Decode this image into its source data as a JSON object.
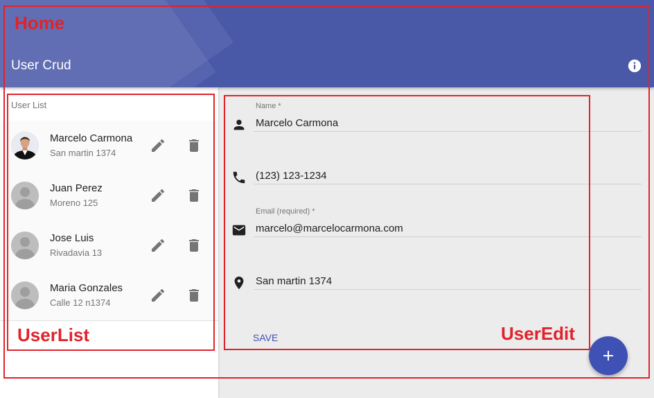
{
  "toolbar": {
    "title": "User Crud",
    "info_icon": "info-icon",
    "color": "#4a58a8"
  },
  "sidebar": {
    "subheader": "User List",
    "users": [
      {
        "name": "Marcelo Carmona",
        "address": "San martin 1374",
        "avatar": "photo"
      },
      {
        "name": "Juan Perez",
        "address": "Moreno 125",
        "avatar": "placeholder"
      },
      {
        "name": "Jose Luis",
        "address": "Rivadavia 13",
        "avatar": "placeholder"
      },
      {
        "name": "Maria Gonzales",
        "address": "Calle 12 n1374",
        "avatar": "placeholder"
      }
    ],
    "edit_icon": "pencil-icon",
    "delete_icon": "trash-icon"
  },
  "form": {
    "name": {
      "label": "Name *",
      "value": "Marcelo Carmona",
      "icon": "person-icon"
    },
    "phone": {
      "label": "",
      "value": "(123) 123-1234",
      "icon": "phone-icon"
    },
    "email": {
      "label": "Email (required) *",
      "value": "marcelo@marcelocarmona.com",
      "icon": "email-icon"
    },
    "address": {
      "label": "",
      "value": "San martin 1374",
      "icon": "location-icon"
    },
    "save_label": "SAVE"
  },
  "fab": {
    "icon": "plus-icon",
    "label": "+"
  },
  "annotations": {
    "home": "Home",
    "user_list": "UserList",
    "user_edit": "UserEdit",
    "color": "#e0232b"
  }
}
